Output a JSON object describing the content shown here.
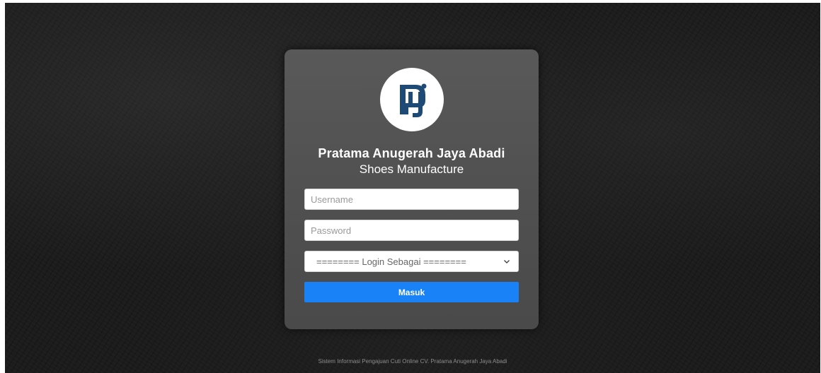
{
  "brand": {
    "logo_icon": "pj-logo-icon",
    "logo_color": "#1e4a75",
    "title": "Pratama Anugerah Jaya Abadi",
    "subtitle": "Shoes Manufacture"
  },
  "form": {
    "username_placeholder": "Username",
    "password_placeholder": "Password",
    "role_select_value": "======== Login Sebagai ========",
    "role_select_icon": "chevron-down-icon",
    "submit_label": "Masuk",
    "submit_color": "#1a82f7"
  },
  "footer": {
    "text": "Sistem Informasi Pengajuan Cuti Online CV. Pratama Anugerah Jaya Abadi"
  }
}
